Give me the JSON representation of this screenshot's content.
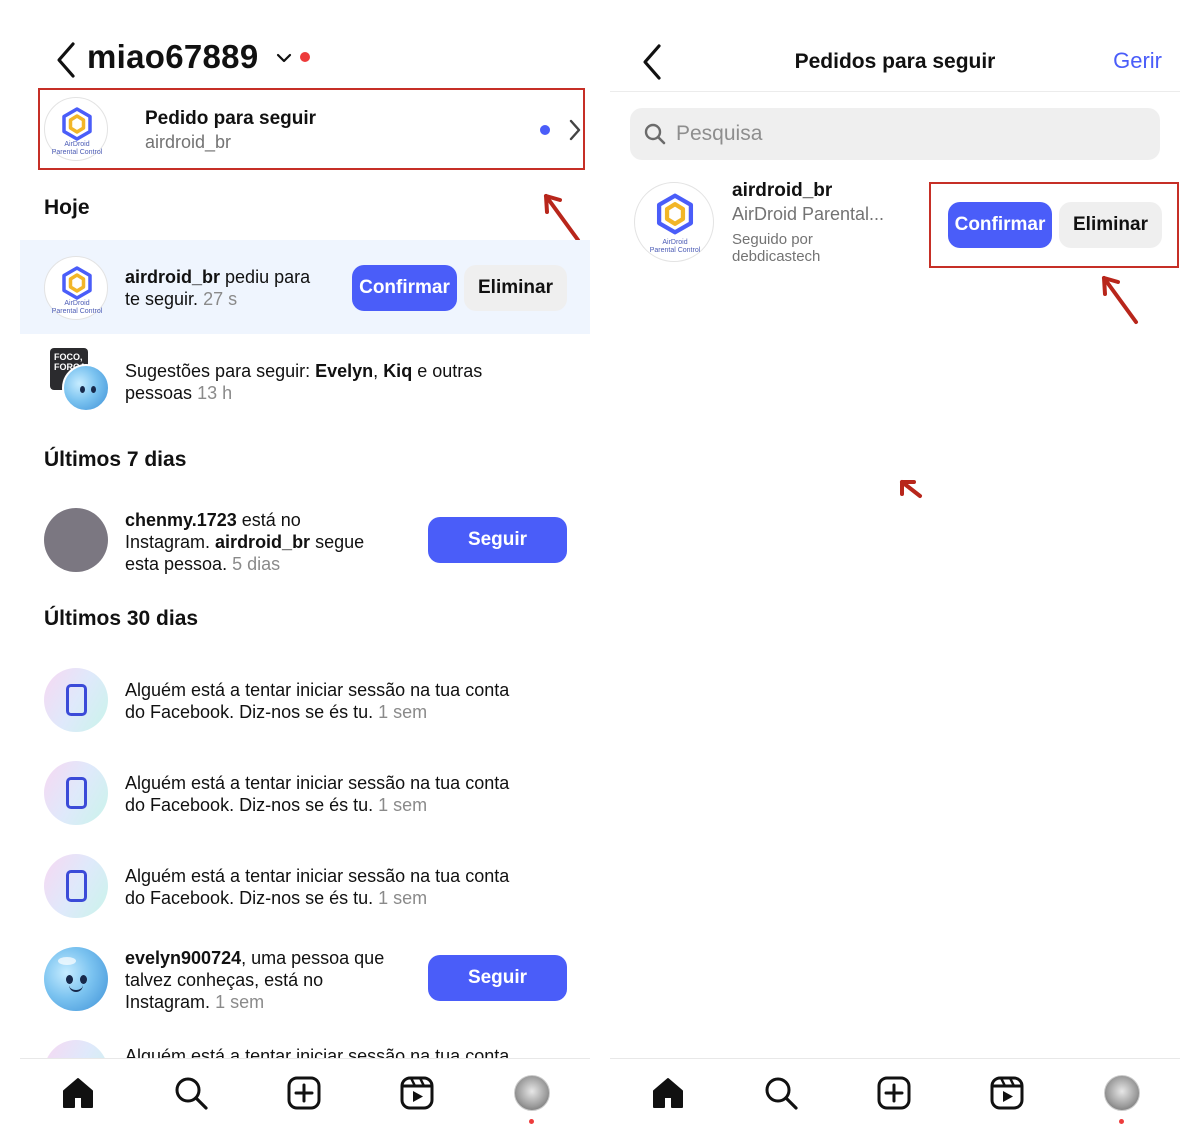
{
  "left": {
    "header": {
      "username": "miao67889"
    },
    "follow_request": {
      "title": "Pedido para seguir",
      "subtitle": "airdroid_br"
    },
    "logo_caption": {
      "line1": "AirDroid",
      "line2": "Parental Control"
    },
    "sections": {
      "today": "Hoje",
      "last7": "Últimos 7 dias",
      "last30": "Últimos 30 dias"
    },
    "today_request": {
      "user": "airdroid_br",
      "text_a": " pediu para",
      "text_b": "te seguir.",
      "time": "27 s",
      "confirm_label": "Confirmar",
      "delete_label": "Eliminar"
    },
    "suggestions": {
      "prefix": "Sugestões para seguir: ",
      "name1": "Evelyn",
      "sep": ", ",
      "name2": "Kiq",
      "suffix": " e outras",
      "line2": "pessoas",
      "time": "13 h",
      "thumb_text": "FOCO, FORÇA"
    },
    "chenmy": {
      "user": "chenmy.1723",
      "t1": " está no",
      "t2": "Instagram. ",
      "user2": "airdroid_br",
      "t3": " segue",
      "t4": "esta pessoa.",
      "time": "5 dias",
      "follow_label": "Seguir"
    },
    "login_alerts": [
      {
        "line1": "Alguém está a tentar iniciar sessão na tua conta",
        "line2": "do Facebook. Diz-nos se és tu.",
        "time": "1 sem"
      },
      {
        "line1": "Alguém está a tentar iniciar sessão na tua conta",
        "line2": "do Facebook. Diz-nos se és tu.",
        "time": "1 sem"
      },
      {
        "line1": "Alguém está a tentar iniciar sessão na tua conta",
        "line2": "do Facebook. Diz-nos se és tu.",
        "time": "1 sem"
      }
    ],
    "evelyn": {
      "user": "evelyn900724",
      "t1": ", uma pessoa que",
      "t2": "talvez conheças, está no",
      "t3": "Instagram.",
      "time": "1 sem",
      "follow_label": "Seguir"
    },
    "partial_text": "Alguém está a tentar iniciar sessão na tua conta"
  },
  "right": {
    "header": {
      "title": "Pedidos para seguir",
      "manage_label": "Gerir"
    },
    "search": {
      "placeholder": "Pesquisa",
      "value": ""
    },
    "request": {
      "username": "airdroid_br",
      "fullname": "AirDroid Parental...",
      "followed_by": "Seguido por debdicastech",
      "confirm_label": "Confirmar",
      "delete_label": "Eliminar"
    }
  },
  "colors": {
    "accent": "#4a5df9",
    "highlight_box": "#c62f26",
    "notification_dot": "#ed3b3b",
    "today_background": "#eff5fe"
  },
  "icons": [
    "back-chevron-icon",
    "search-icon",
    "home-icon",
    "explore-icon",
    "create-post-icon",
    "reels-icon",
    "chevron-right-icon",
    "chevron-down-icon",
    "phone-icon",
    "annotation-arrow-icon"
  ]
}
